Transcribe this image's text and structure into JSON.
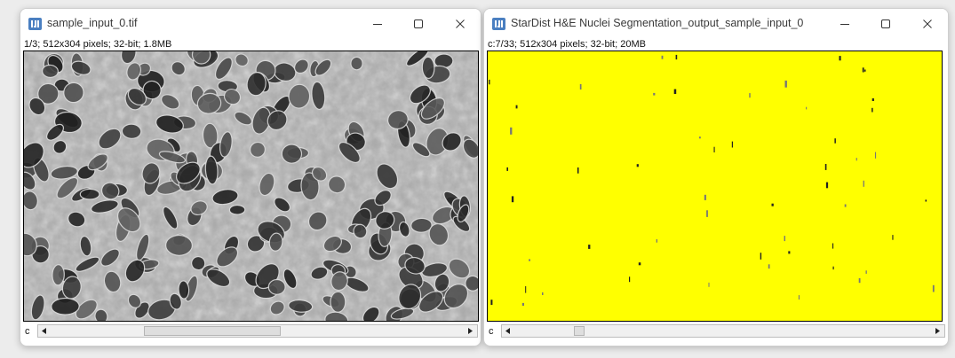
{
  "windows": [
    {
      "title": "sample_input_0.tif",
      "info": "1/3; 512x304 pixels; 32-bit; 1.8MB",
      "channel_label": "c",
      "slider_value_fraction": 0.333,
      "image": "grayscale-he-nuclei-tissue"
    },
    {
      "title": "StarDist H&E Nuclei Segmentation_output_sample_input_0",
      "info": "c:7/33; 512x304 pixels; 32-bit; 20MB",
      "channel_label": "c",
      "slider_value_fraction": 0.212,
      "image": "yellow-segmentation-map"
    }
  ],
  "icons": {
    "app": "imagej-icon",
    "minimize": "minimize-icon",
    "maximize": "maximize-icon",
    "close": "close-icon",
    "left": "arrow-left-icon",
    "right": "arrow-right-icon"
  },
  "colors": {
    "yellow_map": "#ffff00",
    "window_bg": "#ffffff"
  }
}
